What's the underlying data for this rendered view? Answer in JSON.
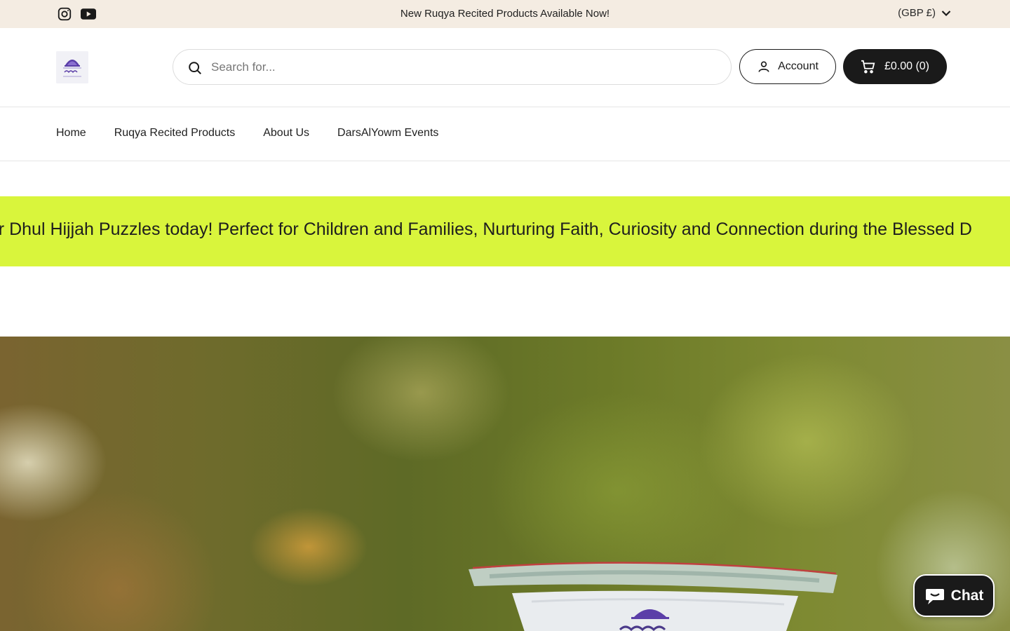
{
  "announcement": {
    "text": "New Ruqya Recited Products Available Now!",
    "currency": "(GBP £)",
    "social_icons": [
      "instagram-icon",
      "youtube-icon"
    ]
  },
  "header": {
    "search_placeholder": "Search for...",
    "account_label": "Account",
    "cart_label": "£0.00 (0)"
  },
  "nav": {
    "items": [
      {
        "label": "Home"
      },
      {
        "label": "Ruqya Recited Products"
      },
      {
        "label": "About Us"
      },
      {
        "label": "DarsAlYowm Events"
      }
    ]
  },
  "marquee": {
    "text": "our Dhul Hijjah Puzzles today! Perfect for Children and Families, Nurturing Faith, Curiosity and Connection during the Blessed D"
  },
  "colors": {
    "announcement_bg": "#f4ece2",
    "marquee_bg": "#d9f53c",
    "cart_bg": "#1a1a1a",
    "brand_purple": "#5b3ea8",
    "chat_green": "#1a1a1a"
  }
}
